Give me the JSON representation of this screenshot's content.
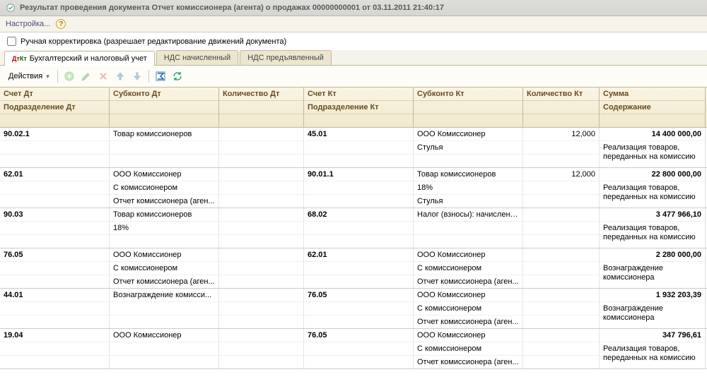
{
  "window": {
    "title": "Результат проведения документа Отчет комиссионера (агента) о продажах 00000000001 от 03.11.2011 21:40:17"
  },
  "toolbar": {
    "settings": "Настройка..."
  },
  "checkbox": {
    "label": "Ручная корректировка (разрешает редактирование движений документа)"
  },
  "tabs": [
    {
      "label": "Бухгалтерский и налоговый учет"
    },
    {
      "label": "НДС начисленный"
    },
    {
      "label": "НДС предъявленный"
    }
  ],
  "actions": {
    "label": "Действия"
  },
  "headers": {
    "schet_dt": "Счет Дт",
    "subkonto_dt": "Субконто Дт",
    "qty_dt": "Количество Дт",
    "schet_kt": "Счет Кт",
    "subkonto_kt": "Субконто Кт",
    "qty_kt": "Количество Кт",
    "summa": "Сумма",
    "podr_dt": "Подразделение Дт",
    "podr_kt": "Подразделение Кт",
    "soderzh": "Содержание"
  },
  "rows": [
    {
      "schet_dt": "90.02.1",
      "sub_dt": [
        "Товар комиссионеров",
        "",
        ""
      ],
      "qty_dt": "",
      "schet_kt": "45.01",
      "sub_kt": [
        "ООО Комиссионер",
        "Стулья",
        ""
      ],
      "qty_kt": "12,000",
      "summa": "14 400 000,00",
      "soderzh": "Реализация товаров, переданных на комиссию"
    },
    {
      "schet_dt": "62.01",
      "sub_dt": [
        "ООО Комиссионер",
        "С комиссионером",
        "Отчет комиссионера (аген..."
      ],
      "qty_dt": "",
      "schet_kt": "90.01.1",
      "sub_kt": [
        "Товар комиссионеров",
        "18%",
        "Стулья"
      ],
      "qty_kt": "12,000",
      "summa": "22 800 000,00",
      "soderzh": "Реализация товаров, переданных на комиссию"
    },
    {
      "schet_dt": "90.03",
      "sub_dt": [
        "Товар комиссионеров",
        "18%",
        ""
      ],
      "qty_dt": "",
      "schet_kt": "68.02",
      "sub_kt": [
        "Налог (взносы): начислено...",
        "",
        ""
      ],
      "qty_kt": "",
      "summa": "3 477 966,10",
      "soderzh": "Реализация товаров, переданных на комиссию"
    },
    {
      "schet_dt": "76.05",
      "sub_dt": [
        "ООО Комиссионер",
        "С комиссионером",
        "Отчет комиссионера (аген..."
      ],
      "qty_dt": "",
      "schet_kt": "62.01",
      "sub_kt": [
        "ООО Комиссионер",
        "С комиссионером",
        "Отчет комиссионера (аген..."
      ],
      "qty_kt": "",
      "summa": "2 280 000,00",
      "soderzh": "Вознаграждение комиссионера"
    },
    {
      "schet_dt": "44.01",
      "sub_dt": [
        "Вознаграждение комисси...",
        "",
        ""
      ],
      "qty_dt": "",
      "schet_kt": "76.05",
      "sub_kt": [
        "ООО Комиссионер",
        "С комиссионером",
        "Отчет комиссионера (аген..."
      ],
      "qty_kt": "",
      "summa": "1 932 203,39",
      "soderzh": "Вознаграждение комиссионера"
    },
    {
      "schet_dt": "19.04",
      "sub_dt": [
        "ООО Комиссионер",
        "",
        ""
      ],
      "qty_dt": "",
      "schet_kt": "76.05",
      "sub_kt": [
        "ООО Комиссионер",
        "С комиссионером",
        "Отчет комиссионера (аген..."
      ],
      "qty_kt": "",
      "summa": "347 796,61",
      "soderzh": "Реализация товаров, переданных на комиссию"
    }
  ]
}
